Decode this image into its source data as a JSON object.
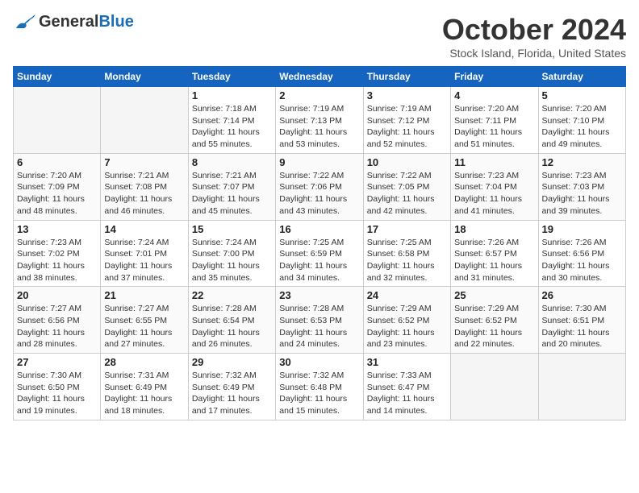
{
  "header": {
    "logo_general": "General",
    "logo_blue": "Blue",
    "month_title": "October 2024",
    "subtitle": "Stock Island, Florida, United States"
  },
  "days_of_week": [
    "Sunday",
    "Monday",
    "Tuesday",
    "Wednesday",
    "Thursday",
    "Friday",
    "Saturday"
  ],
  "weeks": [
    [
      {
        "day": "",
        "empty": true
      },
      {
        "day": "",
        "empty": true
      },
      {
        "day": "1",
        "sunrise": "Sunrise: 7:18 AM",
        "sunset": "Sunset: 7:14 PM",
        "daylight": "Daylight: 11 hours and 55 minutes."
      },
      {
        "day": "2",
        "sunrise": "Sunrise: 7:19 AM",
        "sunset": "Sunset: 7:13 PM",
        "daylight": "Daylight: 11 hours and 53 minutes."
      },
      {
        "day": "3",
        "sunrise": "Sunrise: 7:19 AM",
        "sunset": "Sunset: 7:12 PM",
        "daylight": "Daylight: 11 hours and 52 minutes."
      },
      {
        "day": "4",
        "sunrise": "Sunrise: 7:20 AM",
        "sunset": "Sunset: 7:11 PM",
        "daylight": "Daylight: 11 hours and 51 minutes."
      },
      {
        "day": "5",
        "sunrise": "Sunrise: 7:20 AM",
        "sunset": "Sunset: 7:10 PM",
        "daylight": "Daylight: 11 hours and 49 minutes."
      }
    ],
    [
      {
        "day": "6",
        "sunrise": "Sunrise: 7:20 AM",
        "sunset": "Sunset: 7:09 PM",
        "daylight": "Daylight: 11 hours and 48 minutes."
      },
      {
        "day": "7",
        "sunrise": "Sunrise: 7:21 AM",
        "sunset": "Sunset: 7:08 PM",
        "daylight": "Daylight: 11 hours and 46 minutes."
      },
      {
        "day": "8",
        "sunrise": "Sunrise: 7:21 AM",
        "sunset": "Sunset: 7:07 PM",
        "daylight": "Daylight: 11 hours and 45 minutes."
      },
      {
        "day": "9",
        "sunrise": "Sunrise: 7:22 AM",
        "sunset": "Sunset: 7:06 PM",
        "daylight": "Daylight: 11 hours and 43 minutes."
      },
      {
        "day": "10",
        "sunrise": "Sunrise: 7:22 AM",
        "sunset": "Sunset: 7:05 PM",
        "daylight": "Daylight: 11 hours and 42 minutes."
      },
      {
        "day": "11",
        "sunrise": "Sunrise: 7:23 AM",
        "sunset": "Sunset: 7:04 PM",
        "daylight": "Daylight: 11 hours and 41 minutes."
      },
      {
        "day": "12",
        "sunrise": "Sunrise: 7:23 AM",
        "sunset": "Sunset: 7:03 PM",
        "daylight": "Daylight: 11 hours and 39 minutes."
      }
    ],
    [
      {
        "day": "13",
        "sunrise": "Sunrise: 7:23 AM",
        "sunset": "Sunset: 7:02 PM",
        "daylight": "Daylight: 11 hours and 38 minutes."
      },
      {
        "day": "14",
        "sunrise": "Sunrise: 7:24 AM",
        "sunset": "Sunset: 7:01 PM",
        "daylight": "Daylight: 11 hours and 37 minutes."
      },
      {
        "day": "15",
        "sunrise": "Sunrise: 7:24 AM",
        "sunset": "Sunset: 7:00 PM",
        "daylight": "Daylight: 11 hours and 35 minutes."
      },
      {
        "day": "16",
        "sunrise": "Sunrise: 7:25 AM",
        "sunset": "Sunset: 6:59 PM",
        "daylight": "Daylight: 11 hours and 34 minutes."
      },
      {
        "day": "17",
        "sunrise": "Sunrise: 7:25 AM",
        "sunset": "Sunset: 6:58 PM",
        "daylight": "Daylight: 11 hours and 32 minutes."
      },
      {
        "day": "18",
        "sunrise": "Sunrise: 7:26 AM",
        "sunset": "Sunset: 6:57 PM",
        "daylight": "Daylight: 11 hours and 31 minutes."
      },
      {
        "day": "19",
        "sunrise": "Sunrise: 7:26 AM",
        "sunset": "Sunset: 6:56 PM",
        "daylight": "Daylight: 11 hours and 30 minutes."
      }
    ],
    [
      {
        "day": "20",
        "sunrise": "Sunrise: 7:27 AM",
        "sunset": "Sunset: 6:56 PM",
        "daylight": "Daylight: 11 hours and 28 minutes."
      },
      {
        "day": "21",
        "sunrise": "Sunrise: 7:27 AM",
        "sunset": "Sunset: 6:55 PM",
        "daylight": "Daylight: 11 hours and 27 minutes."
      },
      {
        "day": "22",
        "sunrise": "Sunrise: 7:28 AM",
        "sunset": "Sunset: 6:54 PM",
        "daylight": "Daylight: 11 hours and 26 minutes."
      },
      {
        "day": "23",
        "sunrise": "Sunrise: 7:28 AM",
        "sunset": "Sunset: 6:53 PM",
        "daylight": "Daylight: 11 hours and 24 minutes."
      },
      {
        "day": "24",
        "sunrise": "Sunrise: 7:29 AM",
        "sunset": "Sunset: 6:52 PM",
        "daylight": "Daylight: 11 hours and 23 minutes."
      },
      {
        "day": "25",
        "sunrise": "Sunrise: 7:29 AM",
        "sunset": "Sunset: 6:52 PM",
        "daylight": "Daylight: 11 hours and 22 minutes."
      },
      {
        "day": "26",
        "sunrise": "Sunrise: 7:30 AM",
        "sunset": "Sunset: 6:51 PM",
        "daylight": "Daylight: 11 hours and 20 minutes."
      }
    ],
    [
      {
        "day": "27",
        "sunrise": "Sunrise: 7:30 AM",
        "sunset": "Sunset: 6:50 PM",
        "daylight": "Daylight: 11 hours and 19 minutes."
      },
      {
        "day": "28",
        "sunrise": "Sunrise: 7:31 AM",
        "sunset": "Sunset: 6:49 PM",
        "daylight": "Daylight: 11 hours and 18 minutes."
      },
      {
        "day": "29",
        "sunrise": "Sunrise: 7:32 AM",
        "sunset": "Sunset: 6:49 PM",
        "daylight": "Daylight: 11 hours and 17 minutes."
      },
      {
        "day": "30",
        "sunrise": "Sunrise: 7:32 AM",
        "sunset": "Sunset: 6:48 PM",
        "daylight": "Daylight: 11 hours and 15 minutes."
      },
      {
        "day": "31",
        "sunrise": "Sunrise: 7:33 AM",
        "sunset": "Sunset: 6:47 PM",
        "daylight": "Daylight: 11 hours and 14 minutes."
      },
      {
        "day": "",
        "empty": true
      },
      {
        "day": "",
        "empty": true
      }
    ]
  ]
}
